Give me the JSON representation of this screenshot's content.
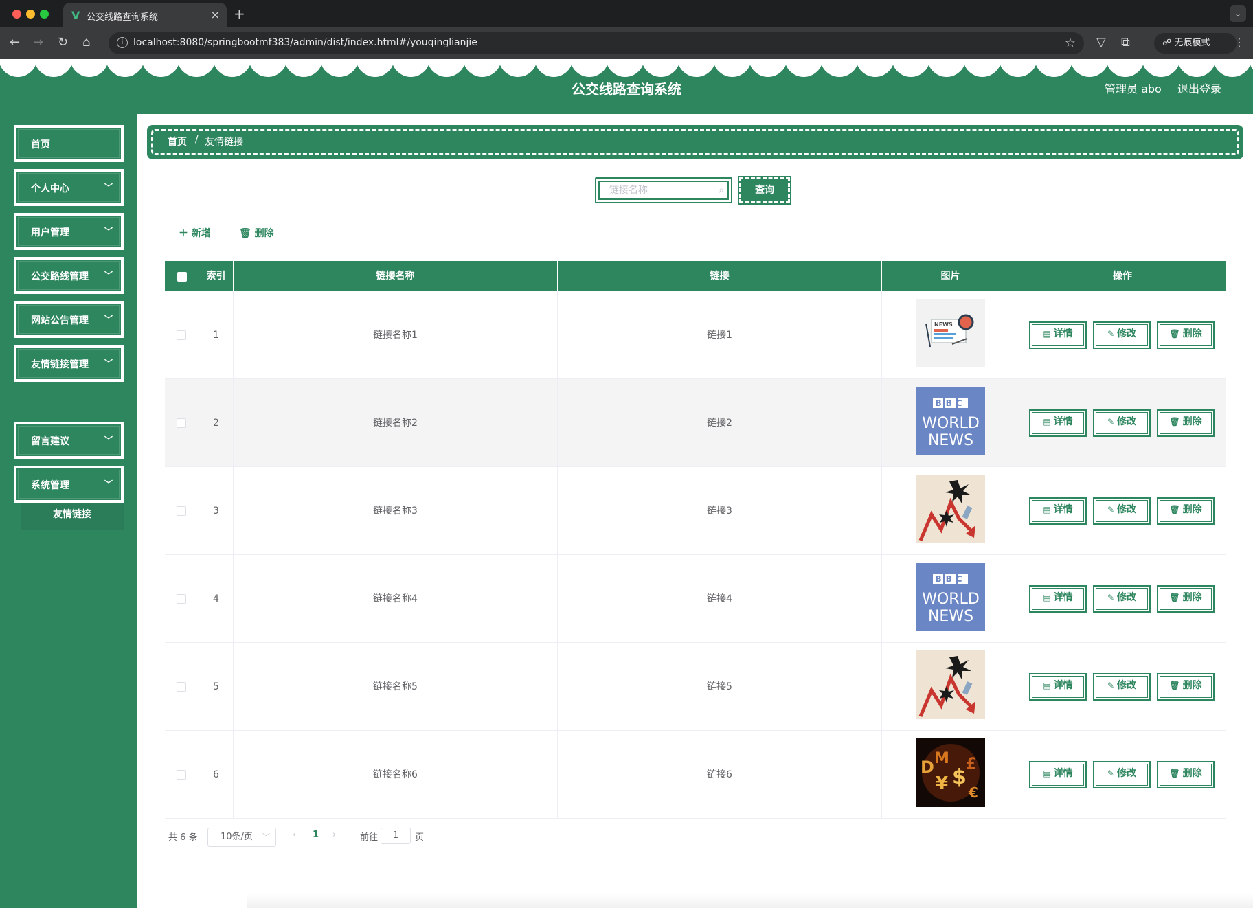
{
  "browser": {
    "tab_title": "公交线路查询系统",
    "url": "localhost:8080/springbootmf383/admin/dist/index.html#/youqinglianjie",
    "incognito": "无痕模式"
  },
  "header": {
    "title": "公交线路查询系统",
    "admin": "管理员 abo",
    "logout": "退出登录"
  },
  "sidebar": {
    "items": [
      {
        "label": "首页"
      },
      {
        "label": "个人中心"
      },
      {
        "label": "用户管理"
      },
      {
        "label": "公交路线管理"
      },
      {
        "label": "网站公告管理"
      },
      {
        "label": "友情链接管理"
      },
      {
        "label": "留言建议"
      },
      {
        "label": "系统管理"
      }
    ],
    "submenu": "友情链接"
  },
  "breadcrumb": {
    "home": "首页",
    "separator": "/",
    "current": "友情链接"
  },
  "search": {
    "placeholder": "链接名称",
    "button": "查询"
  },
  "actions": {
    "add": "新增",
    "delete": "删除"
  },
  "table": {
    "headers": {
      "index": "索引",
      "name": "链接名称",
      "link": "链接",
      "image": "图片",
      "ops": "操作"
    },
    "rows": [
      {
        "index": "1",
        "name": "链接名称1",
        "link": "链接1",
        "image": "news-icon"
      },
      {
        "index": "2",
        "name": "链接名称2",
        "link": "链接2",
        "image": "bbc-world-news"
      },
      {
        "index": "3",
        "name": "链接名称3",
        "link": "链接3",
        "image": "chart-crash"
      },
      {
        "index": "4",
        "name": "链接名称4",
        "link": "链接4",
        "image": "bbc-world-news"
      },
      {
        "index": "5",
        "name": "链接名称5",
        "link": "链接5",
        "image": "chart-crash"
      },
      {
        "index": "6",
        "name": "链接名称6",
        "link": "链接6",
        "image": "currency-symbols"
      }
    ],
    "op_labels": {
      "detail": "详情",
      "edit": "修改",
      "delete": "删除"
    },
    "bbc": {
      "top": "BBC",
      "line1": "WORLD",
      "line2": "NEWS"
    },
    "news_label": "NEWS"
  },
  "pagination": {
    "total": "共 6 条",
    "size": "10条/页",
    "page": "1",
    "goto": "前往",
    "jump_value": "1",
    "page_unit": "页"
  },
  "colors": {
    "primary": "#2e865f"
  }
}
